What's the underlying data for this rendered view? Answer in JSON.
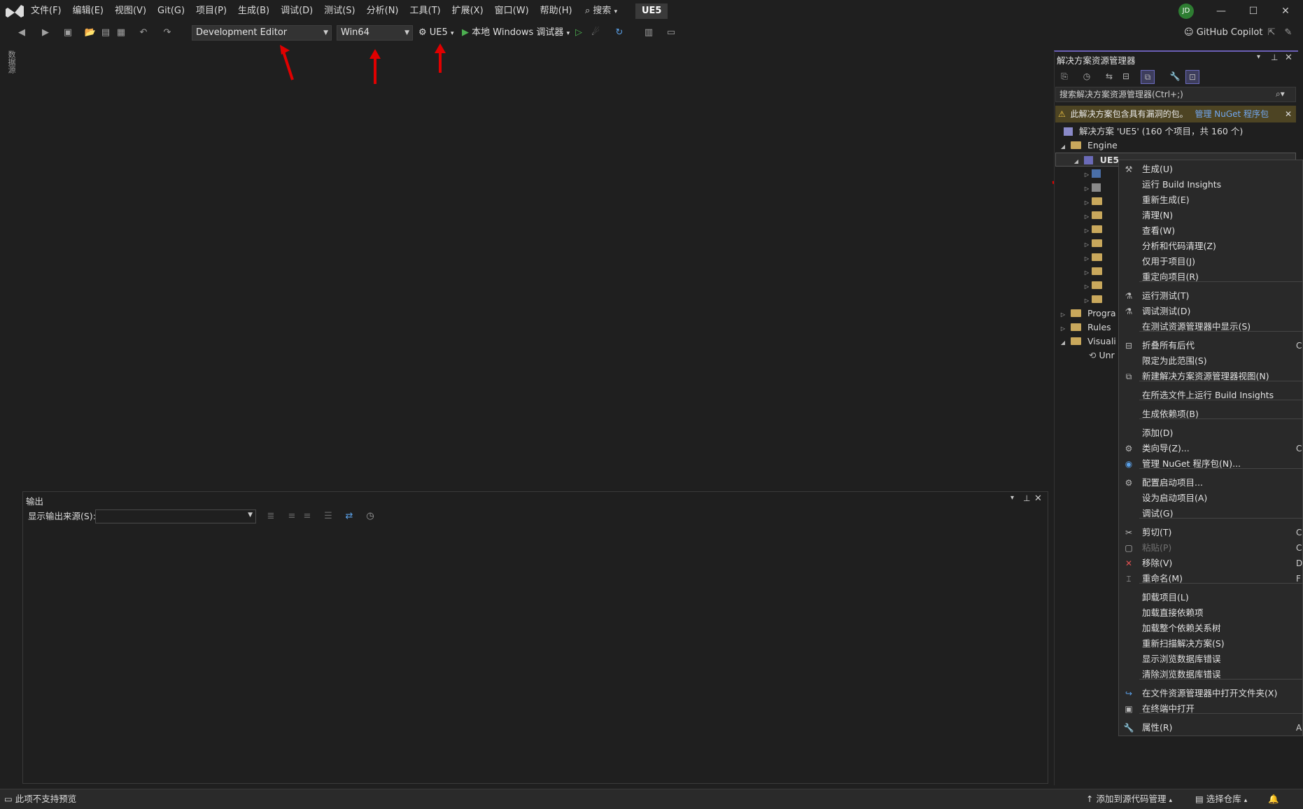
{
  "menu": {
    "items": [
      "文件(F)",
      "编辑(E)",
      "视图(V)",
      "Git(G)",
      "项目(P)",
      "生成(B)",
      "调试(D)",
      "测试(S)",
      "分析(N)",
      "工具(T)",
      "扩展(X)",
      "窗口(W)",
      "帮助(H)"
    ],
    "search_label": "搜索",
    "solution_badge": "UE5",
    "user_initials": "JD"
  },
  "toolbar": {
    "configuration": "Development Editor",
    "platform": "Win64",
    "startup_project": "UE5",
    "debugger": "本地 Windows 调试器",
    "copilot": "GitHub Copilot"
  },
  "left_tab": "数据源",
  "solution_explorer": {
    "title": "解决方案资源管理器",
    "search_placeholder": "搜索解决方案资源管理器(Ctrl+;)",
    "warning_text": "此解决方案包含具有漏洞的包。",
    "warning_link": "管理 NuGet 程序包",
    "tree": [
      {
        "label": "解决方案 'UE5' (160 个项目，共 160 个)"
      },
      {
        "label": "Engine"
      },
      {
        "label": "UE5"
      },
      {
        "label": "Progra"
      },
      {
        "label": "Rules"
      },
      {
        "label": "Visuali"
      },
      {
        "label": "Unr"
      }
    ]
  },
  "context_menu": {
    "items": [
      "生成(U)",
      "运行 Build Insights",
      "重新生成(E)",
      "清理(N)",
      "查看(W)",
      "分析和代码清理(Z)",
      "仅用于项目(J)",
      "重定向项目(R)",
      "运行测试(T)",
      "调试测试(D)",
      "在测试资源管理器中显示(S)",
      "折叠所有后代",
      "限定为此范围(S)",
      "新建解决方案资源管理器视图(N)",
      "在所选文件上运行 Build Insights",
      "生成依赖项(B)",
      "添加(D)",
      "类向导(Z)...",
      "管理 NuGet 程序包(N)...",
      "配置启动项目...",
      "设为启动项目(A)",
      "调试(G)",
      "剪切(T)",
      "粘贴(P)",
      "移除(V)",
      "重命名(M)",
      "卸载项目(L)",
      "加载直接依赖项",
      "加载整个依赖关系树",
      "重新扫描解决方案(S)",
      "显示浏览数据库错误",
      "清除浏览数据库错误",
      "在文件资源管理器中打开文件夹(X)",
      "在终端中打开",
      "属性(R)"
    ],
    "shortcut_fragments": [
      "C",
      "C",
      "C",
      "C",
      "D",
      "F",
      "A"
    ]
  },
  "output": {
    "title": "输出",
    "source_label": "显示输出来源(S):"
  },
  "status": {
    "left": "此项不支持预览",
    "add_source_control": "添加到源代码管理",
    "select_repo": "选择仓库"
  }
}
